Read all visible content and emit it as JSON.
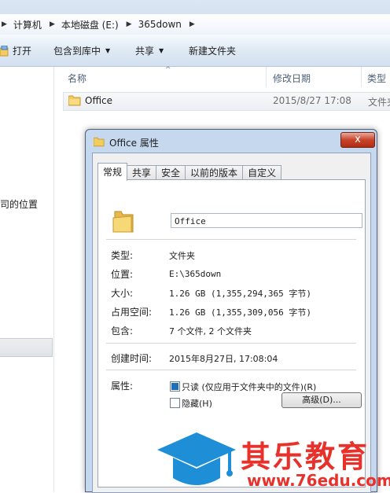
{
  "explorer": {
    "breadcrumb": [
      "计算机",
      "本地磁盘 (E:)",
      "365down"
    ],
    "toolbar": {
      "open": "打开",
      "include_in_library": "包含到库中",
      "share": "共享",
      "new_folder": "新建文件夹"
    },
    "nav": {
      "partial_label": "司的位置"
    },
    "columns": {
      "name": "名称",
      "modified": "修改日期",
      "type": "类型"
    },
    "files": [
      {
        "name": "Office",
        "modified": "2015/8/27 17:08",
        "type": "文件夹"
      }
    ]
  },
  "dialog": {
    "title": "Office 属性",
    "close_symbol": "x",
    "tabs": [
      "常规",
      "共享",
      "安全",
      "以前的版本",
      "自定义"
    ],
    "active_tab": "常规",
    "folder_name": "Office",
    "properties": {
      "type_label": "类型:",
      "type_value": "文件夹",
      "location_label": "位置:",
      "location_value": "E:\\365down",
      "size_label": "大小:",
      "size_value": "1.26 GB (1,355,294,365 字节)",
      "size_on_disk_label": "占用空间:",
      "size_on_disk_value": "1.26 GB (1,355,309,056 字节)",
      "contains_label": "包含:",
      "contains_value": "7 个文件, 2 个文件夹",
      "created_label": "创建时间:",
      "created_value": "2015年8月27日, 17:08:04",
      "attributes_label": "属性:"
    },
    "attributes": {
      "readonly_label": "只读 (仅应用于文件夹中的文件)(R)",
      "readonly_checked": true,
      "hidden_label": "隐藏(H)",
      "hidden_checked": false,
      "advanced_button": "高级(D)..."
    }
  },
  "watermark": {
    "brand": "其乐教育",
    "url": "www.76edu.com",
    "colors": {
      "red": "#e8312b",
      "blue": "#1e8fd6"
    }
  },
  "colors": {
    "accent": "#1f6fb6",
    "folder": "#f3cc5e"
  }
}
